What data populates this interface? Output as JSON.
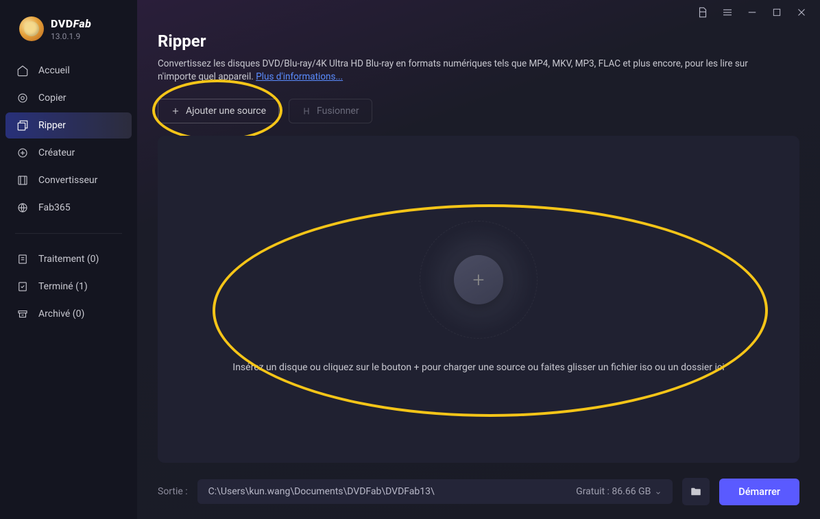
{
  "app": {
    "brand_main": "DVD",
    "brand_suffix": "Fab",
    "version": "13.0.1.9"
  },
  "sidebar": {
    "items": [
      {
        "label": "Accueil",
        "icon": "home"
      },
      {
        "label": "Copier",
        "icon": "copy"
      },
      {
        "label": "Ripper",
        "icon": "ripper"
      },
      {
        "label": "Créateur",
        "icon": "creator"
      },
      {
        "label": "Convertisseur",
        "icon": "converter"
      },
      {
        "label": "Fab365",
        "icon": "fab365"
      }
    ],
    "status": [
      {
        "label": "Traitement (0)"
      },
      {
        "label": "Terminé (1)"
      },
      {
        "label": "Archivé (0)"
      }
    ]
  },
  "page": {
    "title": "Ripper",
    "description_a": "Convertissez les disques DVD/Blu-ray/4K Ultra HD Blu-ray en formats numériques tels que MP4, MKV, MP3, FLAC et plus encore, pour les lire sur n'importe quel appareil. ",
    "more_link": "Plus d'informations..."
  },
  "toolbar": {
    "add_source": "Ajouter une source",
    "merge": "Fusionner"
  },
  "dropzone": {
    "hint": "Insérez un disque ou cliquez sur le bouton +  pour charger une source ou faites glisser un fichier iso ou un dossier ici"
  },
  "footer": {
    "output_label": "Sortie :",
    "output_path": "C:\\Users\\kun.wang\\Documents\\DVDFab\\DVDFab13\\",
    "free_label": "Gratuit : 86.66 GB",
    "start": "Démarrer"
  }
}
